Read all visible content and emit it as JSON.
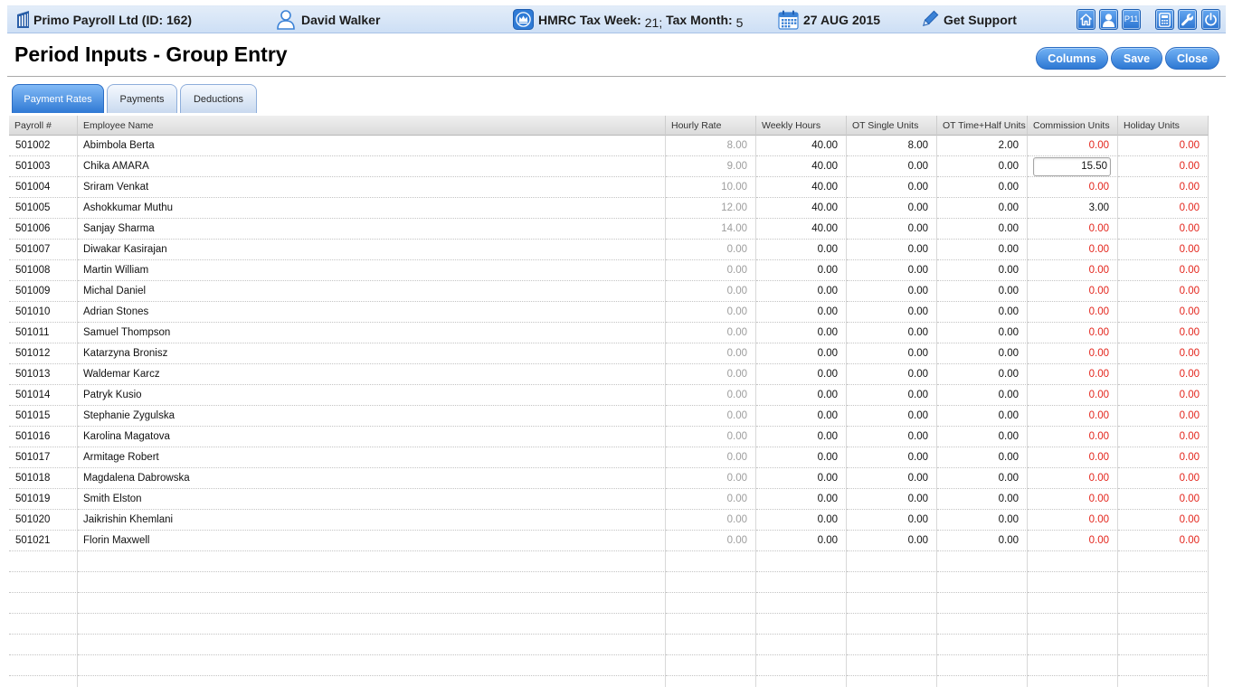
{
  "topbar": {
    "company": "Primo Payroll Ltd (ID: 162)",
    "user": "David Walker",
    "hmrc": {
      "week_label": "HMRC Tax Week:",
      "week_value": "21",
      "week_sep": ";",
      "month_label": "Tax Month:",
      "month_value": "5"
    },
    "date": "27 AUG 2015",
    "support": "Get Support",
    "p11_label": "P11"
  },
  "icons": {
    "company": "building-icon",
    "user": "user-outline-icon",
    "hmrc": "hmrc-crown-icon",
    "date": "calendar-icon",
    "support": "pencil-icon",
    "tools": [
      "home-icon",
      "user-icon",
      "calculator-icon",
      "wrench-icon",
      "power-icon"
    ]
  },
  "page": {
    "title": "Period Inputs - Group Entry"
  },
  "actions": {
    "columns": "Columns",
    "save": "Save",
    "close": "Close"
  },
  "tabs": [
    {
      "label": "Payment Rates",
      "active": true
    },
    {
      "label": "Payments",
      "active": false
    },
    {
      "label": "Deductions",
      "active": false
    }
  ],
  "table": {
    "columns": [
      "Payroll #",
      "Employee Name",
      "Hourly Rate",
      "Weekly Hours",
      "OT Single Units",
      "OT Time+Half Units",
      "Commission Units",
      "Holiday Units"
    ],
    "rows": [
      [
        "501002",
        "Abimbola Berta",
        "8.00",
        "40.00",
        "8.00",
        "2.00",
        "0.00",
        "0.00"
      ],
      [
        "501003",
        "Chika AMARA",
        "9.00",
        "40.00",
        "0.00",
        "0.00",
        "15.50",
        "0.00"
      ],
      [
        "501004",
        "Sriram Venkat",
        "10.00",
        "40.00",
        "0.00",
        "0.00",
        "0.00",
        "0.00"
      ],
      [
        "501005",
        "Ashokkumar Muthu",
        "12.00",
        "40.00",
        "0.00",
        "0.00",
        "3.00",
        "0.00"
      ],
      [
        "501006",
        "Sanjay Sharma",
        "14.00",
        "40.00",
        "0.00",
        "0.00",
        "0.00",
        "0.00"
      ],
      [
        "501007",
        "Diwakar Kasirajan",
        "0.00",
        "0.00",
        "0.00",
        "0.00",
        "0.00",
        "0.00"
      ],
      [
        "501008",
        "Martin William",
        "0.00",
        "0.00",
        "0.00",
        "0.00",
        "0.00",
        "0.00"
      ],
      [
        "501009",
        "Michal Daniel",
        "0.00",
        "0.00",
        "0.00",
        "0.00",
        "0.00",
        "0.00"
      ],
      [
        "501010",
        "Adrian Stones",
        "0.00",
        "0.00",
        "0.00",
        "0.00",
        "0.00",
        "0.00"
      ],
      [
        "501011",
        "Samuel Thompson",
        "0.00",
        "0.00",
        "0.00",
        "0.00",
        "0.00",
        "0.00"
      ],
      [
        "501012",
        "Katarzyna Bronisz",
        "0.00",
        "0.00",
        "0.00",
        "0.00",
        "0.00",
        "0.00"
      ],
      [
        "501013",
        "Waldemar Karcz",
        "0.00",
        "0.00",
        "0.00",
        "0.00",
        "0.00",
        "0.00"
      ],
      [
        "501014",
        "Patryk Kusio",
        "0.00",
        "0.00",
        "0.00",
        "0.00",
        "0.00",
        "0.00"
      ],
      [
        "501015",
        "Stephanie Zygulska",
        "0.00",
        "0.00",
        "0.00",
        "0.00",
        "0.00",
        "0.00"
      ],
      [
        "501016",
        "Karolina Magatova",
        "0.00",
        "0.00",
        "0.00",
        "0.00",
        "0.00",
        "0.00"
      ],
      [
        "501017",
        "Armitage Robert",
        "0.00",
        "0.00",
        "0.00",
        "0.00",
        "0.00",
        "0.00"
      ],
      [
        "501018",
        "Magdalena Dabrowska",
        "0.00",
        "0.00",
        "0.00",
        "0.00",
        "0.00",
        "0.00"
      ],
      [
        "501019",
        "Smith Elston",
        "0.00",
        "0.00",
        "0.00",
        "0.00",
        "0.00",
        "0.00"
      ],
      [
        "501020",
        "Jaikrishin Khemlani",
        "0.00",
        "0.00",
        "0.00",
        "0.00",
        "0.00",
        "0.00"
      ],
      [
        "501021",
        "Florin Maxwell",
        "0.00",
        "0.00",
        "0.00",
        "0.00",
        "0.00",
        "0.00"
      ]
    ],
    "active_cell": {
      "row": 1,
      "col": 6
    },
    "muted_columns": [
      2
    ],
    "alert_zero_columns": [
      6,
      7
    ]
  },
  "colors": {
    "brand_blue": "#2f7bd6",
    "alert_red": "#e3251c",
    "muted_gray": "#9d9d9d",
    "topbar_bg": "#cddff5"
  }
}
